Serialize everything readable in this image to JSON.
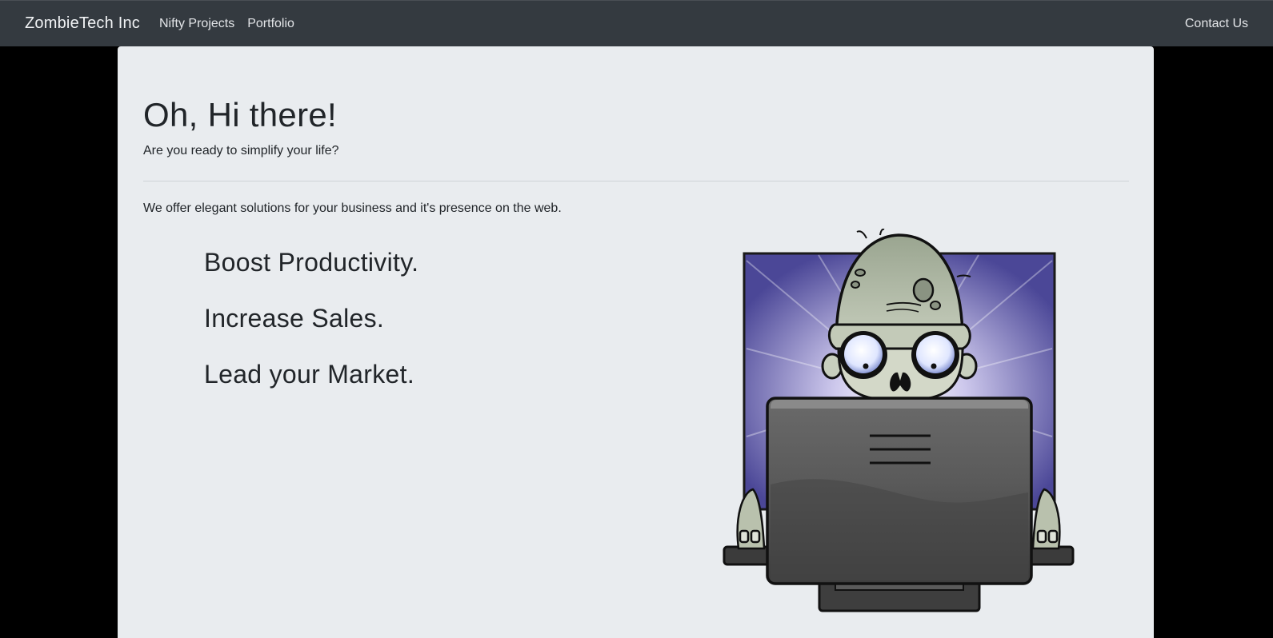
{
  "navbar": {
    "brand": "ZombieTech Inc",
    "links": [
      "Nifty Projects",
      "Portfolio"
    ],
    "contact": "Contact Us"
  },
  "hero": {
    "heading": "Oh, Hi there!",
    "lead": "Are you ready to simplify your life?",
    "offer": "We offer elegant solutions for your business and it's presence on the web.",
    "benefits": [
      "Boost Productivity.",
      "Increase Sales.",
      "Lead your Market."
    ]
  },
  "illustration": {
    "icon": "zombie-at-laptop-illustration"
  }
}
